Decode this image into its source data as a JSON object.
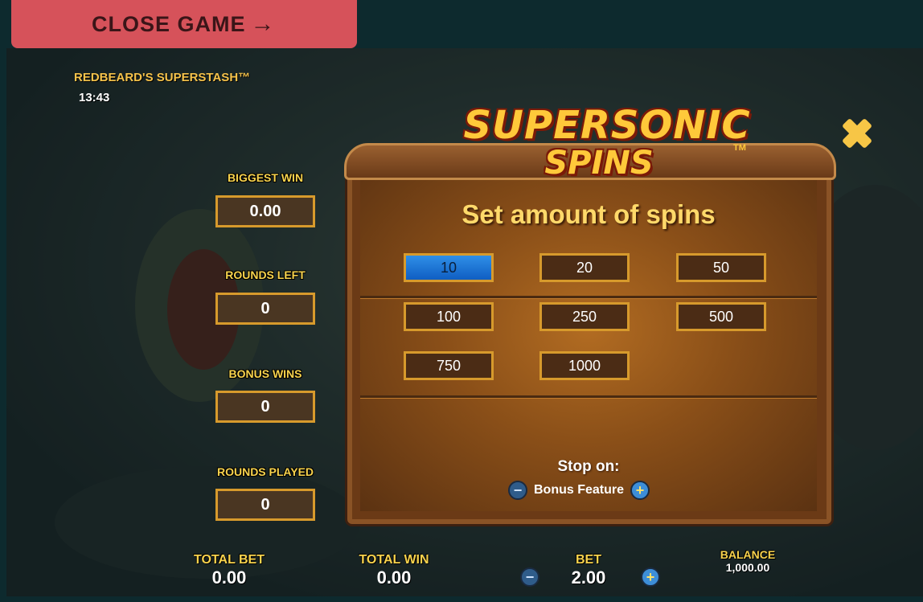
{
  "close_game": {
    "label": "CLOSE GAME",
    "icon": "arrow-right-icon"
  },
  "game": {
    "title": "REDBEARD'S SUPERSTASH™",
    "clock": "13:43"
  },
  "stats": [
    {
      "label": "BIGGEST WIN",
      "value": "0.00"
    },
    {
      "label": "ROUNDS LEFT",
      "value": "0"
    },
    {
      "label": "BONUS WINS",
      "value": "0"
    },
    {
      "label": "ROUNDS PLAYED",
      "value": "0"
    }
  ],
  "dialog": {
    "logo": {
      "line1": "SUPERSONIC",
      "line2": "SPINS",
      "tm": "TM"
    },
    "heading": "Set amount of spins",
    "spin_options": [
      {
        "label": "10",
        "selected": true
      },
      {
        "label": "20",
        "selected": false
      },
      {
        "label": "50",
        "selected": false
      },
      {
        "label": "100",
        "selected": false
      },
      {
        "label": "250",
        "selected": false
      },
      {
        "label": "500",
        "selected": false
      },
      {
        "label": "750",
        "selected": false
      },
      {
        "label": "1000",
        "selected": false
      }
    ],
    "stop_on": {
      "label": "Stop on:",
      "option": "Bonus Feature",
      "minus": "−",
      "plus": "+"
    },
    "close_icon": "close-x-icon"
  },
  "footer": {
    "total_bet": {
      "label": "TOTAL BET",
      "value": "0.00"
    },
    "total_win": {
      "label": "TOTAL WIN",
      "value": "0.00"
    },
    "bet": {
      "label": "BET",
      "value": "2.00",
      "minus": "−",
      "plus": "+"
    },
    "balance": {
      "label": "BALANCE",
      "value": "1,000.00"
    }
  },
  "colors": {
    "accent": "#f8d34d",
    "close_button": "#d6525a",
    "selected_option": "#1f7ad8",
    "frame": "#d79a2c"
  }
}
